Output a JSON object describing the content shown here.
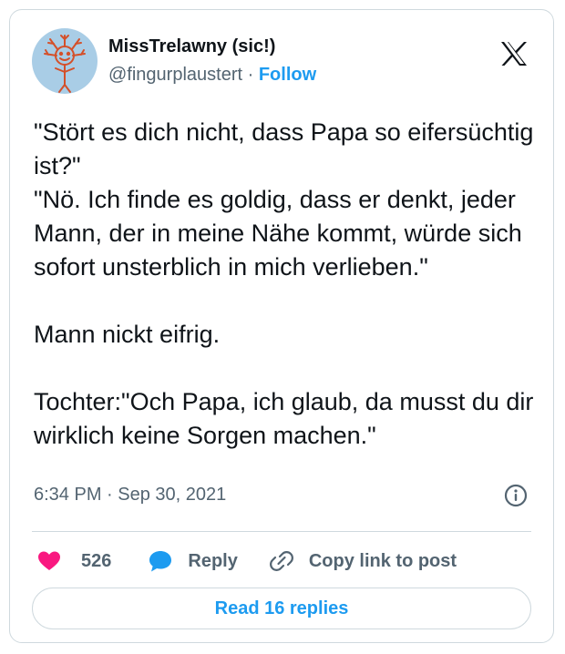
{
  "author": {
    "display_name": "MissTrelawny (sic!)",
    "handle": "@fingurplaustert",
    "separator": "·",
    "follow_label": "Follow",
    "avatar_icon": "hand-drawn-sun-face-avatar"
  },
  "platform_logo": "x-logo-icon",
  "tweet": {
    "text": "\"Stört es dich nicht, dass Papa so eifersüchtig ist?\"\n\"Nö. Ich finde es goldig, dass er denkt, jeder Mann, der in meine Nähe kommt, würde sich sofort unsterblich in mich verlieben.\"\n\nMann nickt eifrig.\n\nTochter:\"Och Papa, ich glaub, da musst du dir wirklich keine Sorgen machen.\"",
    "timestamp": "6:34 PM · Sep 30, 2021"
  },
  "actions": {
    "like_count": "526",
    "reply_label": "Reply",
    "copy_link_label": "Copy link to post"
  },
  "read_replies_label": "Read 16 replies",
  "colors": {
    "accent": "#1d9bf0",
    "like": "#f91880",
    "text": "#0f1419",
    "secondary": "#536471",
    "border": "#cfd9de",
    "avatar_bg": "#a9cde6",
    "avatar_drawing": "#d4502a"
  }
}
